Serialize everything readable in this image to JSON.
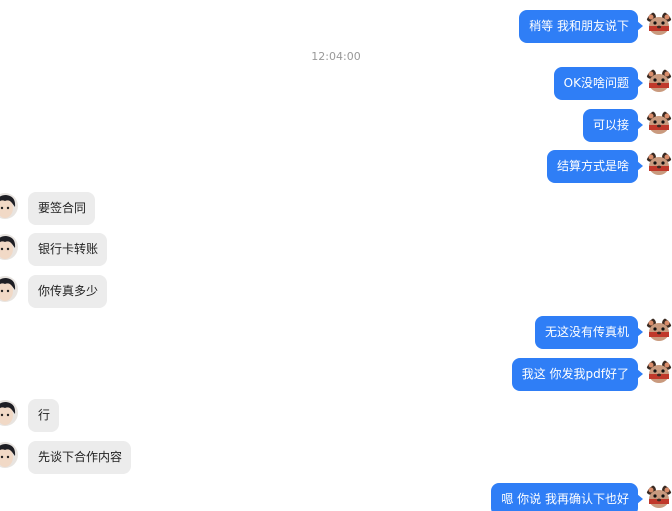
{
  "timestamp": "12:04:00",
  "messages": [
    {
      "text": "稍等 我和朋友说下"
    },
    {
      "text": "OK没啥问题"
    },
    {
      "text": "可以接"
    },
    {
      "text": "结算方式是啥"
    },
    {
      "text": "要签合同"
    },
    {
      "text": "银行卡转账"
    },
    {
      "text": "你传真多少"
    },
    {
      "text": "无这没有传真机"
    },
    {
      "text": "我这 你发我pdf好了"
    },
    {
      "text": "行"
    },
    {
      "text": "先谈下合作内容"
    },
    {
      "text": "嗯 你说 我再确认下也好"
    }
  ],
  "icons": {
    "me_avatar": "cartoon-mouse-avatar",
    "them_avatar": "person-portrait-avatar"
  },
  "colors": {
    "outgoing_bubble": "#2f7ef6",
    "incoming_bubble": "#ececec",
    "timestamp_text": "#999999"
  }
}
